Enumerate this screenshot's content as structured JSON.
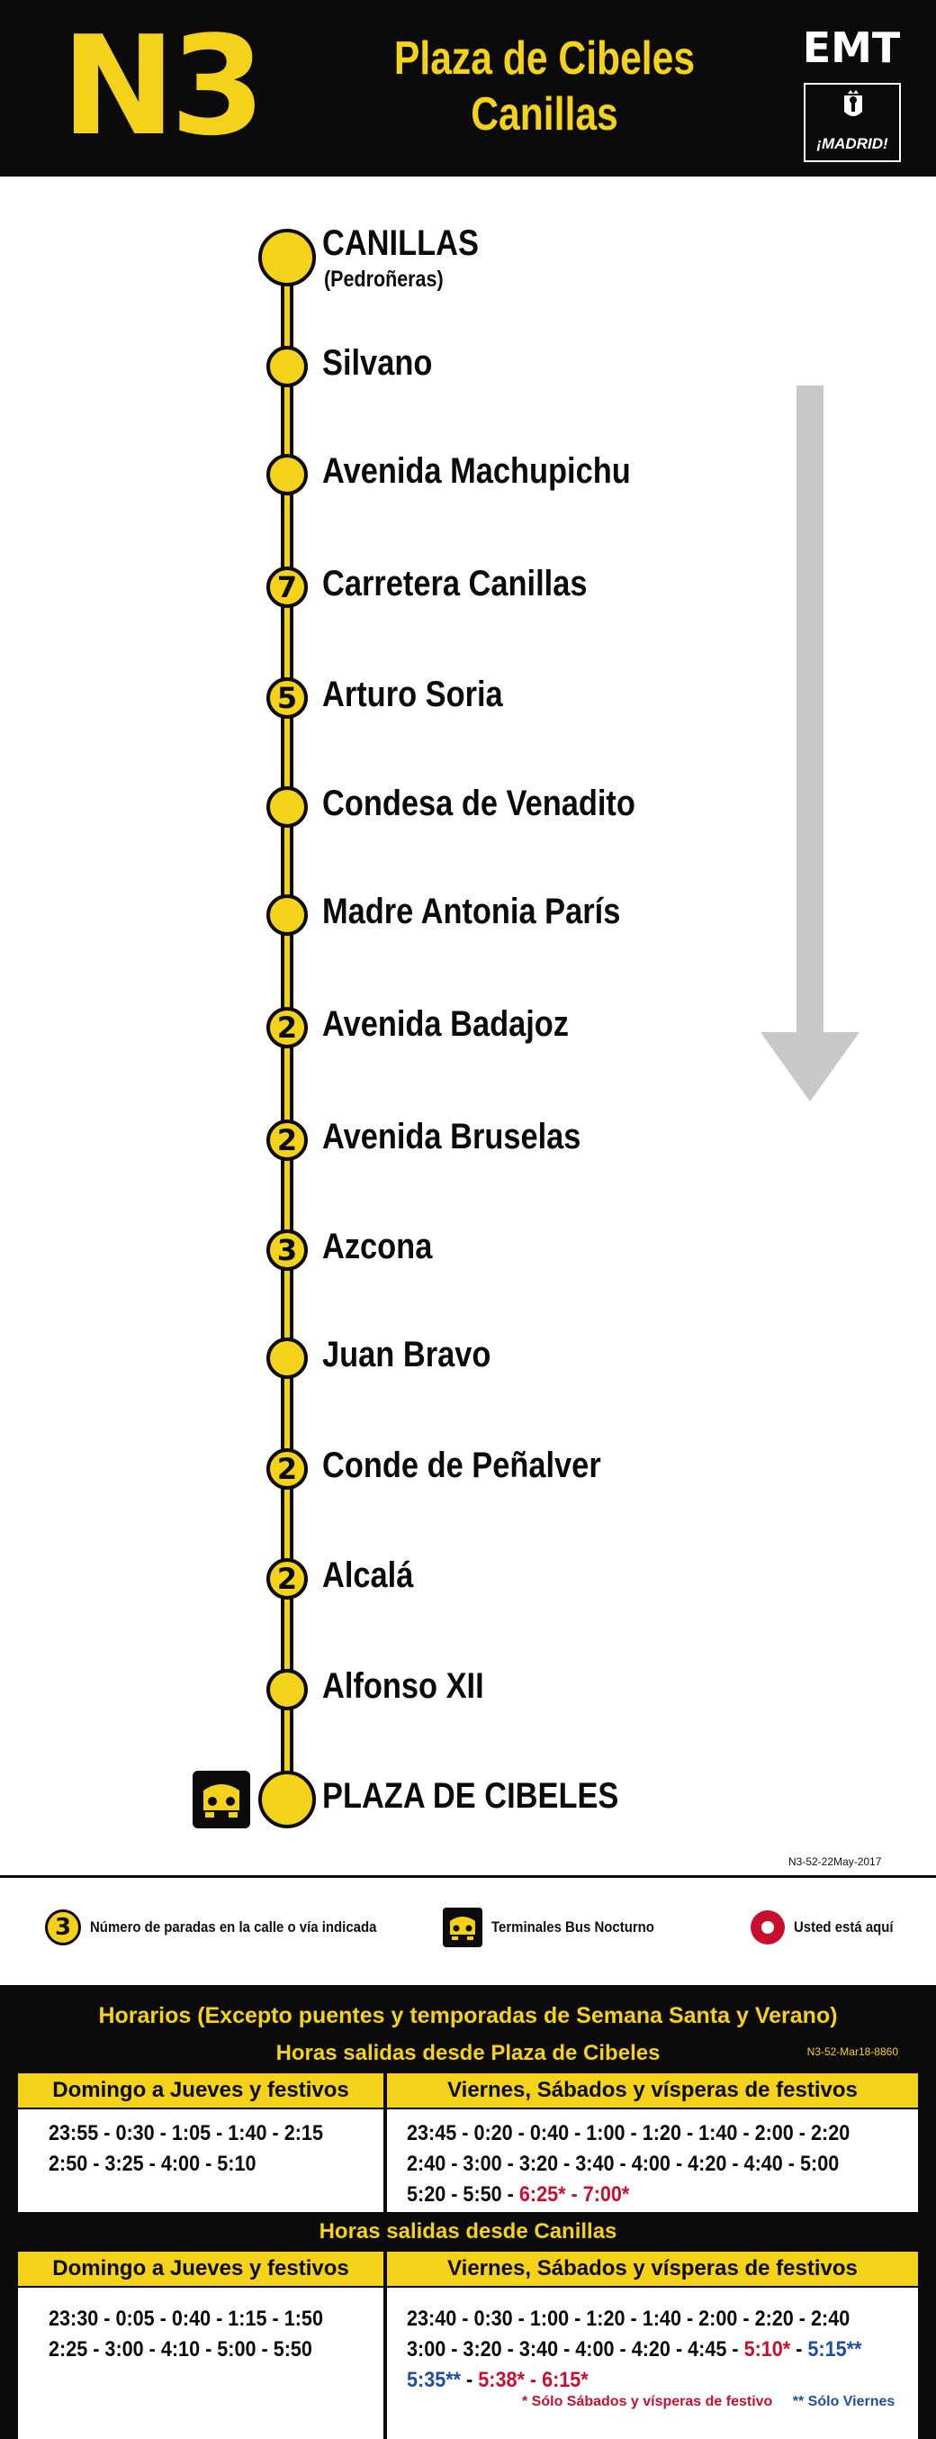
{
  "header": {
    "line_code": "N3",
    "destination_1": "Plaza de Cibeles",
    "destination_2": "Canillas",
    "operator": "EMT",
    "city_badge": "¡MADRID!"
  },
  "stops": [
    {
      "name": "CANILLAS",
      "sub": "(Pedroñeras)",
      "count": "",
      "terminal": true
    },
    {
      "name": "Silvano",
      "count": ""
    },
    {
      "name": "Avenida Machupichu",
      "count": ""
    },
    {
      "name": "Carretera Canillas",
      "count": "7"
    },
    {
      "name": "Arturo Soria",
      "count": "5"
    },
    {
      "name": "Condesa de Venadito",
      "count": ""
    },
    {
      "name": "Madre Antonia París",
      "count": ""
    },
    {
      "name": "Avenida Badajoz",
      "count": "2"
    },
    {
      "name": "Avenida Bruselas",
      "count": "2"
    },
    {
      "name": "Azcona",
      "count": "3"
    },
    {
      "name": "Juan Bravo",
      "count": ""
    },
    {
      "name": "Conde de Peñalver",
      "count": "2"
    },
    {
      "name": "Alcalá",
      "count": "2"
    },
    {
      "name": "Alfonso XII",
      "count": ""
    },
    {
      "name": "PLAZA DE CIBELES",
      "count": "",
      "terminal": true
    }
  ],
  "version_code": "N3-52-22May-2017",
  "legend": {
    "stops_icon_number": "3",
    "stops_text": "Número de paradas en la calle o vía indicada",
    "night_terminal_text": "Terminales Bus Nocturno",
    "here_text": "Usted está aquí"
  },
  "schedule": {
    "title": "Horarios (Excepto puentes y temporadas de Semana Santa y Verano)",
    "section_1": {
      "title": "Horas salidas desde Plaza de Cibeles",
      "code": "N3-52-Mar18-8860",
      "col_left_header": "Domingo a Jueves y festivos",
      "col_right_header": "Viernes, Sábados y vísperas de festivos",
      "left_lines": [
        "23:55 - 0:30 - 1:05 - 1:40 - 2:15",
        "2:50 - 3:25 - 4:00 - 5:10"
      ],
      "right_line_1": "23:45 - 0:20 - 0:40 - 1:00 - 1:20 - 1:40 - 2:00 - 2:20",
      "right_line_2": "2:40 - 3:00 - 3:20 - 3:40 - 4:00 - 4:20 - 4:40 - 5:00",
      "right_line_3_plain": "5:20 - 5:50 - ",
      "right_line_3_red": "6:25* - 7:00*"
    },
    "section_2": {
      "title": "Horas salidas desde Canillas",
      "col_left_header": "Domingo a Jueves y festivos",
      "col_right_header": "Viernes, Sábados y vísperas de festivos",
      "left_lines": [
        "23:30 - 0:05 - 0:40 - 1:15 - 1:50",
        "2:25 - 3:00 - 4:10 - 5:00 - 5:50"
      ],
      "right_line_1": "23:40 - 0:30 - 1:00 - 1:20 - 1:40 - 2:00 - 2:20 - 2:40",
      "right_line_2_plain": "3:00 - 3:20 - 3:40 - 4:00 - 4:20 - 4:45 - ",
      "right_line_2_red": "5:10*",
      "right_line_2_sep": " - ",
      "right_line_2_blue": "5:15**",
      "right_line_3_blue": "5:35**",
      "right_line_3_sep": " - ",
      "right_line_3_red": "5:38* - 6:15*"
    },
    "note_saturday": "* Sólo Sábados y vísperas de festivo",
    "note_friday": "** Sólo Viernes"
  },
  "colors": {
    "brand_yellow": "#f5d21a",
    "black": "#0b0b0b",
    "red": "#c8102e",
    "blue": "#1f4fa0",
    "arrow_gray": "#c8c8c8"
  }
}
